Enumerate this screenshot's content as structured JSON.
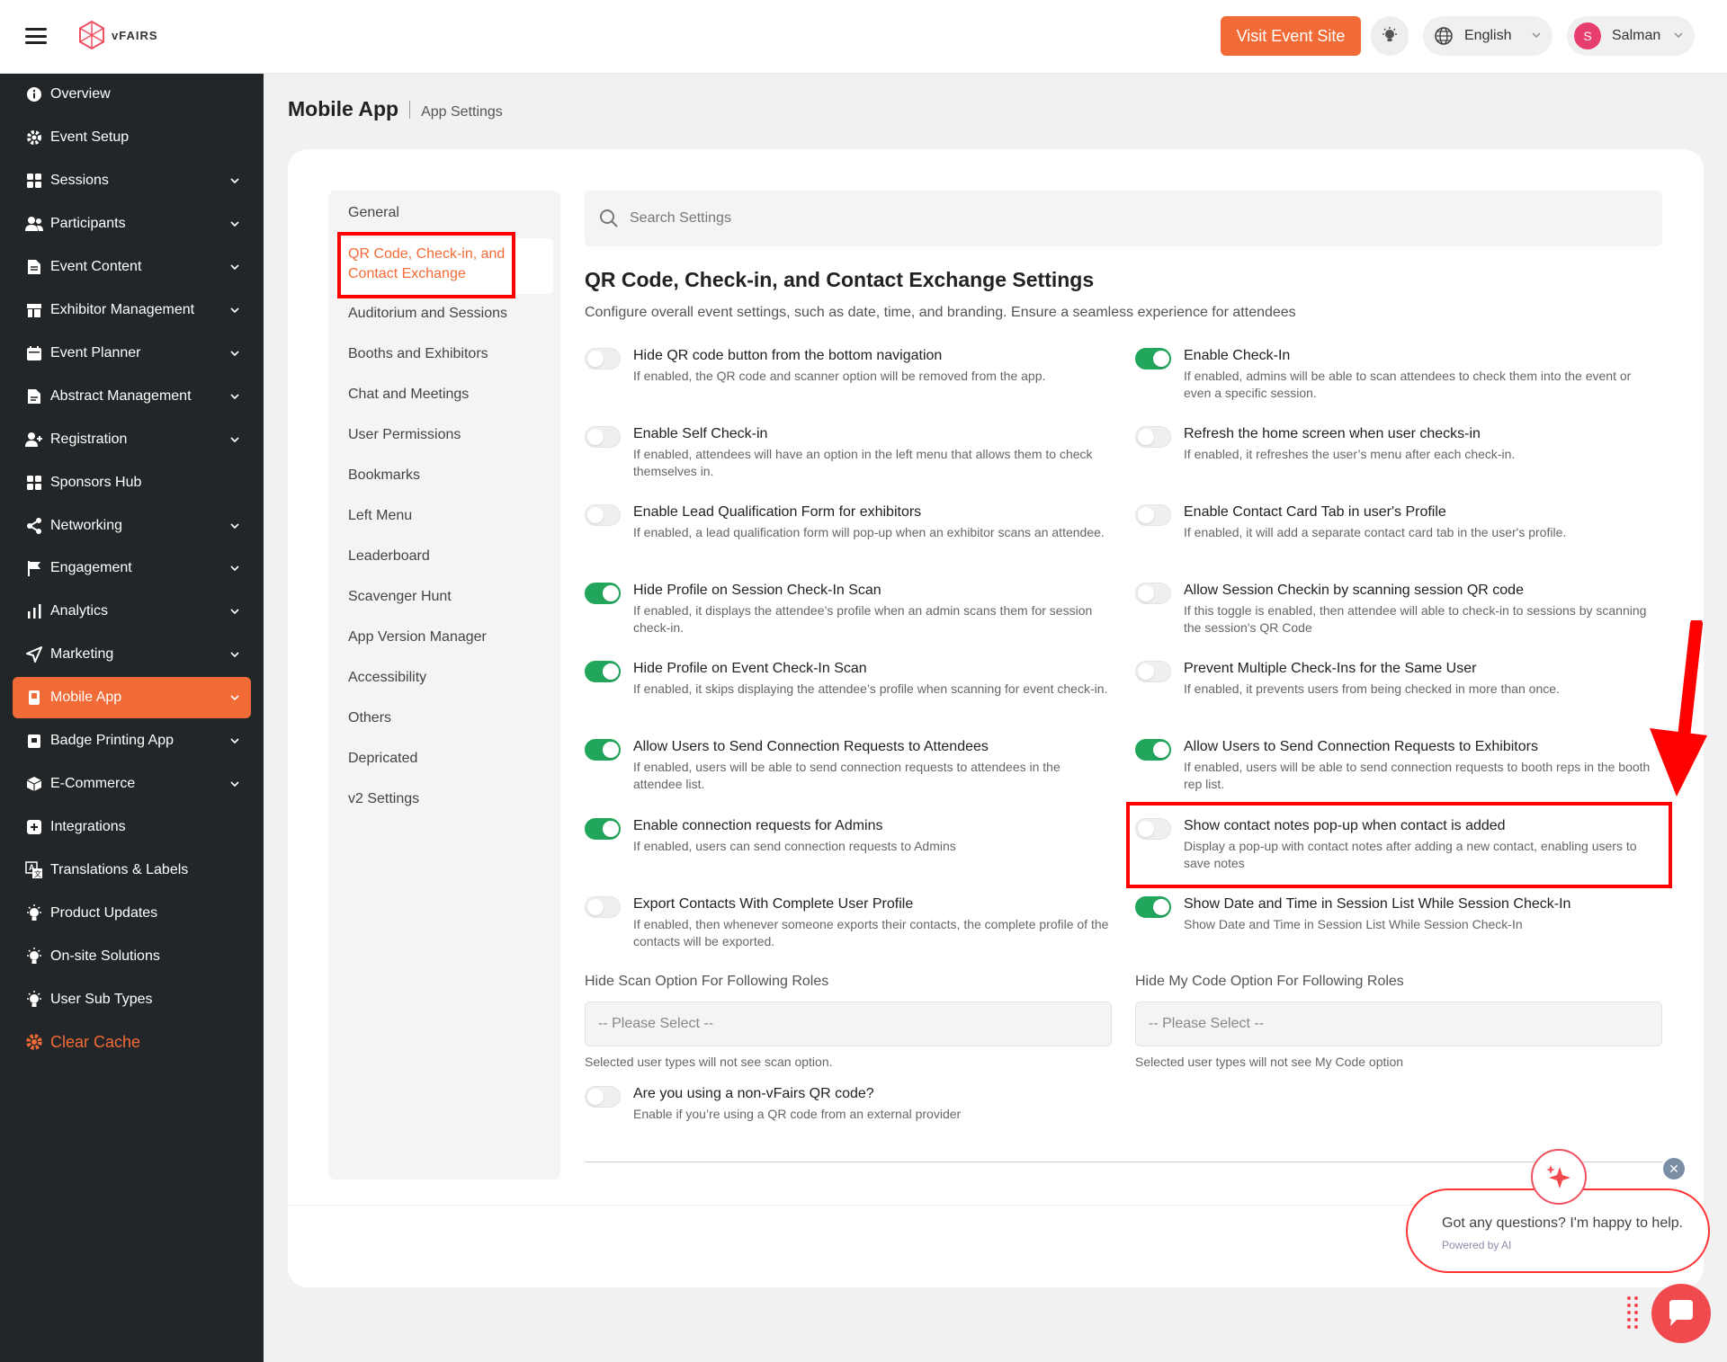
{
  "header": {
    "logo_text": "vFAIRS",
    "visit_button": "Visit Event Site",
    "language": "English",
    "user_initial": "S",
    "user_name": "Salman",
    "accent_color": "#f26b36"
  },
  "sidebar": {
    "items": [
      {
        "label": "Overview",
        "icon": "info-icon",
        "chevron": false
      },
      {
        "label": "Event Setup",
        "icon": "gear-icon",
        "chevron": false
      },
      {
        "label": "Sessions",
        "icon": "grid-icon",
        "chevron": true
      },
      {
        "label": "Participants",
        "icon": "users-icon",
        "chevron": true
      },
      {
        "label": "Event Content",
        "icon": "document-icon",
        "chevron": true
      },
      {
        "label": "Exhibitor Management",
        "icon": "booth-icon",
        "chevron": true
      },
      {
        "label": "Event Planner",
        "icon": "calendar-icon",
        "chevron": true
      },
      {
        "label": "Abstract Management",
        "icon": "file-icon",
        "chevron": true
      },
      {
        "label": "Registration",
        "icon": "user-add-icon",
        "chevron": true
      },
      {
        "label": "Sponsors Hub",
        "icon": "grid-icon",
        "chevron": false
      },
      {
        "label": "Networking",
        "icon": "share-icon",
        "chevron": true
      },
      {
        "label": "Engagement",
        "icon": "flag-icon",
        "chevron": true
      },
      {
        "label": "Analytics",
        "icon": "bar-chart-icon",
        "chevron": true
      },
      {
        "label": "Marketing",
        "icon": "send-icon",
        "chevron": true
      },
      {
        "label": "Mobile App",
        "icon": "mobile-icon",
        "chevron": true,
        "active": true
      },
      {
        "label": "Badge Printing App",
        "icon": "badge-icon",
        "chevron": true
      },
      {
        "label": "E-Commerce",
        "icon": "box-icon",
        "chevron": true
      },
      {
        "label": "Integrations",
        "icon": "plus-square-icon",
        "chevron": false
      },
      {
        "label": "Translations & Labels",
        "icon": "translate-icon",
        "chevron": false
      },
      {
        "label": "Product Updates",
        "icon": "bulb-icon",
        "chevron": false
      },
      {
        "label": "On-site Solutions",
        "icon": "bulb-icon",
        "chevron": false
      },
      {
        "label": "User Sub Types",
        "icon": "bulb-icon",
        "chevron": false
      }
    ],
    "clear_cache": "Clear Cache"
  },
  "page": {
    "title": "Mobile App",
    "subtitle": "App Settings"
  },
  "settings_nav": {
    "items": [
      "General",
      "QR Code, Check-in, and Contact Exchange",
      "Auditorium and Sessions",
      "Booths and Exhibitors",
      "Chat and Meetings",
      "User Permissions",
      "Bookmarks",
      "Left Menu",
      "Leaderboard",
      "Scavenger Hunt",
      "App Version Manager",
      "Accessibility",
      "Others",
      "Depricated",
      "v2 Settings"
    ],
    "active_index": 1
  },
  "search": {
    "placeholder": "Search Settings"
  },
  "section": {
    "title": "QR Code, Check-in, and Contact Exchange Settings",
    "description": "Configure overall event settings, such as date, time, and branding. Ensure a seamless experience for attendees"
  },
  "settings_left": [
    {
      "title": "Hide QR code button from the bottom navigation",
      "description": "If enabled, the QR code and scanner option will be removed from the app.",
      "enabled": false
    },
    {
      "title": "Enable Self Check-in",
      "description": "If enabled, attendees will have an option in the left menu that allows them to check themselves in.",
      "enabled": false
    },
    {
      "title": "Enable Lead Qualification Form for exhibitors",
      "description": "If enabled, a lead qualification form will pop-up when an exhibitor scans an attendee.",
      "enabled": false
    },
    {
      "title": "Hide Profile on Session Check-In Scan",
      "description": "If enabled, it displays the attendee’s profile when an admin scans them for session check-in.",
      "enabled": true
    },
    {
      "title": "Hide Profile on Event Check-In Scan",
      "description": "If enabled, it skips displaying the attendee’s profile when scanning for event check-in.",
      "enabled": true
    },
    {
      "title": "Allow Users to Send Connection Requests to Attendees",
      "description": "If enabled, users will be able to send connection requests to attendees in the attendee list.",
      "enabled": true
    },
    {
      "title": "Enable connection requests for Admins",
      "description": "If enabled, users can send connection requests to Admins",
      "enabled": true
    },
    {
      "title": "Export Contacts With Complete User Profile",
      "description": "If enabled, then whenever someone exports their contacts, the complete profile of the contacts will be exported.",
      "enabled": false
    }
  ],
  "settings_right": [
    {
      "title": "Enable Check-In",
      "description": "If enabled, admins will be able to scan attendees to check them into the event or even a specific session.",
      "enabled": true
    },
    {
      "title": "Refresh the home screen when user checks-in",
      "description": "If enabled, it refreshes the user’s menu after each check-in.",
      "enabled": false
    },
    {
      "title": "Enable Contact Card Tab in user's Profile",
      "description": "If enabled, it will add a separate contact card tab in the user's profile.",
      "enabled": false
    },
    {
      "title": "Allow Session Checkin by scanning session QR code",
      "description": "If this toggle is enabled, then attendee will able to check-in to sessions by scanning the session's QR Code",
      "enabled": false
    },
    {
      "title": "Prevent Multiple Check-Ins for the Same User",
      "description": "If enabled, it prevents users from being checked in more than once.",
      "enabled": false
    },
    {
      "title": "Allow Users to Send Connection Requests to Exhibitors",
      "description": "If enabled, users will be able to send connection requests to booth reps in the booth rep list.",
      "enabled": true
    },
    {
      "title": "Show contact notes pop-up when contact is added",
      "description": "Display a pop-up with contact notes after adding a new contact, enabling users to save notes",
      "enabled": false
    },
    {
      "title": "Show Date and Time in Session List While Session Check-In",
      "description": "Show Date and Time in Session List While Session Check-In",
      "enabled": true
    }
  ],
  "selects": {
    "scan_roles": {
      "label": "Hide Scan Option For Following Roles",
      "placeholder": "-- Please Select --",
      "help": "Selected user types will not see scan option."
    },
    "mycode_roles": {
      "label": "Hide My Code Option For Following Roles",
      "placeholder": "-- Please Select --",
      "help": "Selected user types will not see My Code option"
    }
  },
  "non_vfairs": {
    "title": "Are you using a non-vFairs QR code?",
    "description": "Enable if you’re using a QR code from an external provider",
    "enabled": false
  },
  "chat": {
    "message": "Got any questions? I'm happy to help.",
    "powered": "Powered by AI"
  },
  "colors": {
    "toggle_on": "#22a65b",
    "annotation": "#ff0000",
    "sidebar_bg": "#232628"
  }
}
